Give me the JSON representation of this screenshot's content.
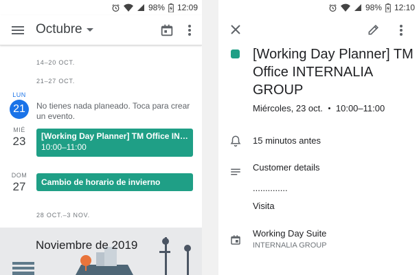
{
  "left_screen": {
    "status": {
      "battery": "98%",
      "time": "12:09"
    },
    "appbar": {
      "month": "Octubre"
    },
    "weeks": [
      {
        "label": "14–20 OCT."
      },
      {
        "label": "21–27 OCT."
      },
      {
        "label": "28 OCT.–3 NOV."
      }
    ],
    "days": [
      {
        "name": "LUN",
        "number": "21"
      },
      {
        "name": "MIÉ",
        "number": "23"
      },
      {
        "name": "DOM",
        "number": "27"
      }
    ],
    "empty_message": "No tienes nada planeado. Toca para crear un evento.",
    "events": [
      {
        "title": "[Working Day Planner] TM Office INTERNALIA GROUP",
        "time": "10:00–11:00"
      },
      {
        "title": "Cambio de horario de invierno"
      }
    ],
    "month_banner": {
      "title": "Noviembre de 2019"
    }
  },
  "right_screen": {
    "status": {
      "battery": "98%",
      "time": "12:10"
    },
    "event": {
      "title": "[Working Day Planner] TM Office INTERNALIA GROUP",
      "date": "Miércoles, 23 oct.",
      "time": "10:00–11:00",
      "color": "#1f9f86"
    },
    "reminder": "15 minutos antes",
    "description_lines": [
      "Customer details",
      "..............",
      "Visita"
    ],
    "calendar": {
      "name": "Working Day Suite",
      "account": "INTERNALIA GROUP"
    }
  }
}
